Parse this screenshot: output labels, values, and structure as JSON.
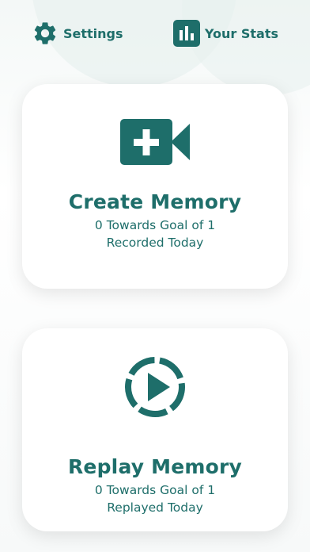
{
  "topbar": {
    "settings_label": "Settings",
    "stats_label": "Your Stats"
  },
  "cards": {
    "create": {
      "title": "Create Memory",
      "line1": "0 Towards Goal of 1",
      "line2": "Recorded Today"
    },
    "replay": {
      "title": "Replay Memory",
      "line1": "0 Towards Goal of 1",
      "line2": "Replayed Today"
    }
  },
  "icons": {
    "settings": "gear-icon",
    "stats": "bar-chart-icon",
    "create": "video-camera-plus-icon",
    "replay": "play-circle-icon"
  },
  "colors": {
    "accent": "#1e6e6a",
    "card_bg": "#ffffff"
  }
}
